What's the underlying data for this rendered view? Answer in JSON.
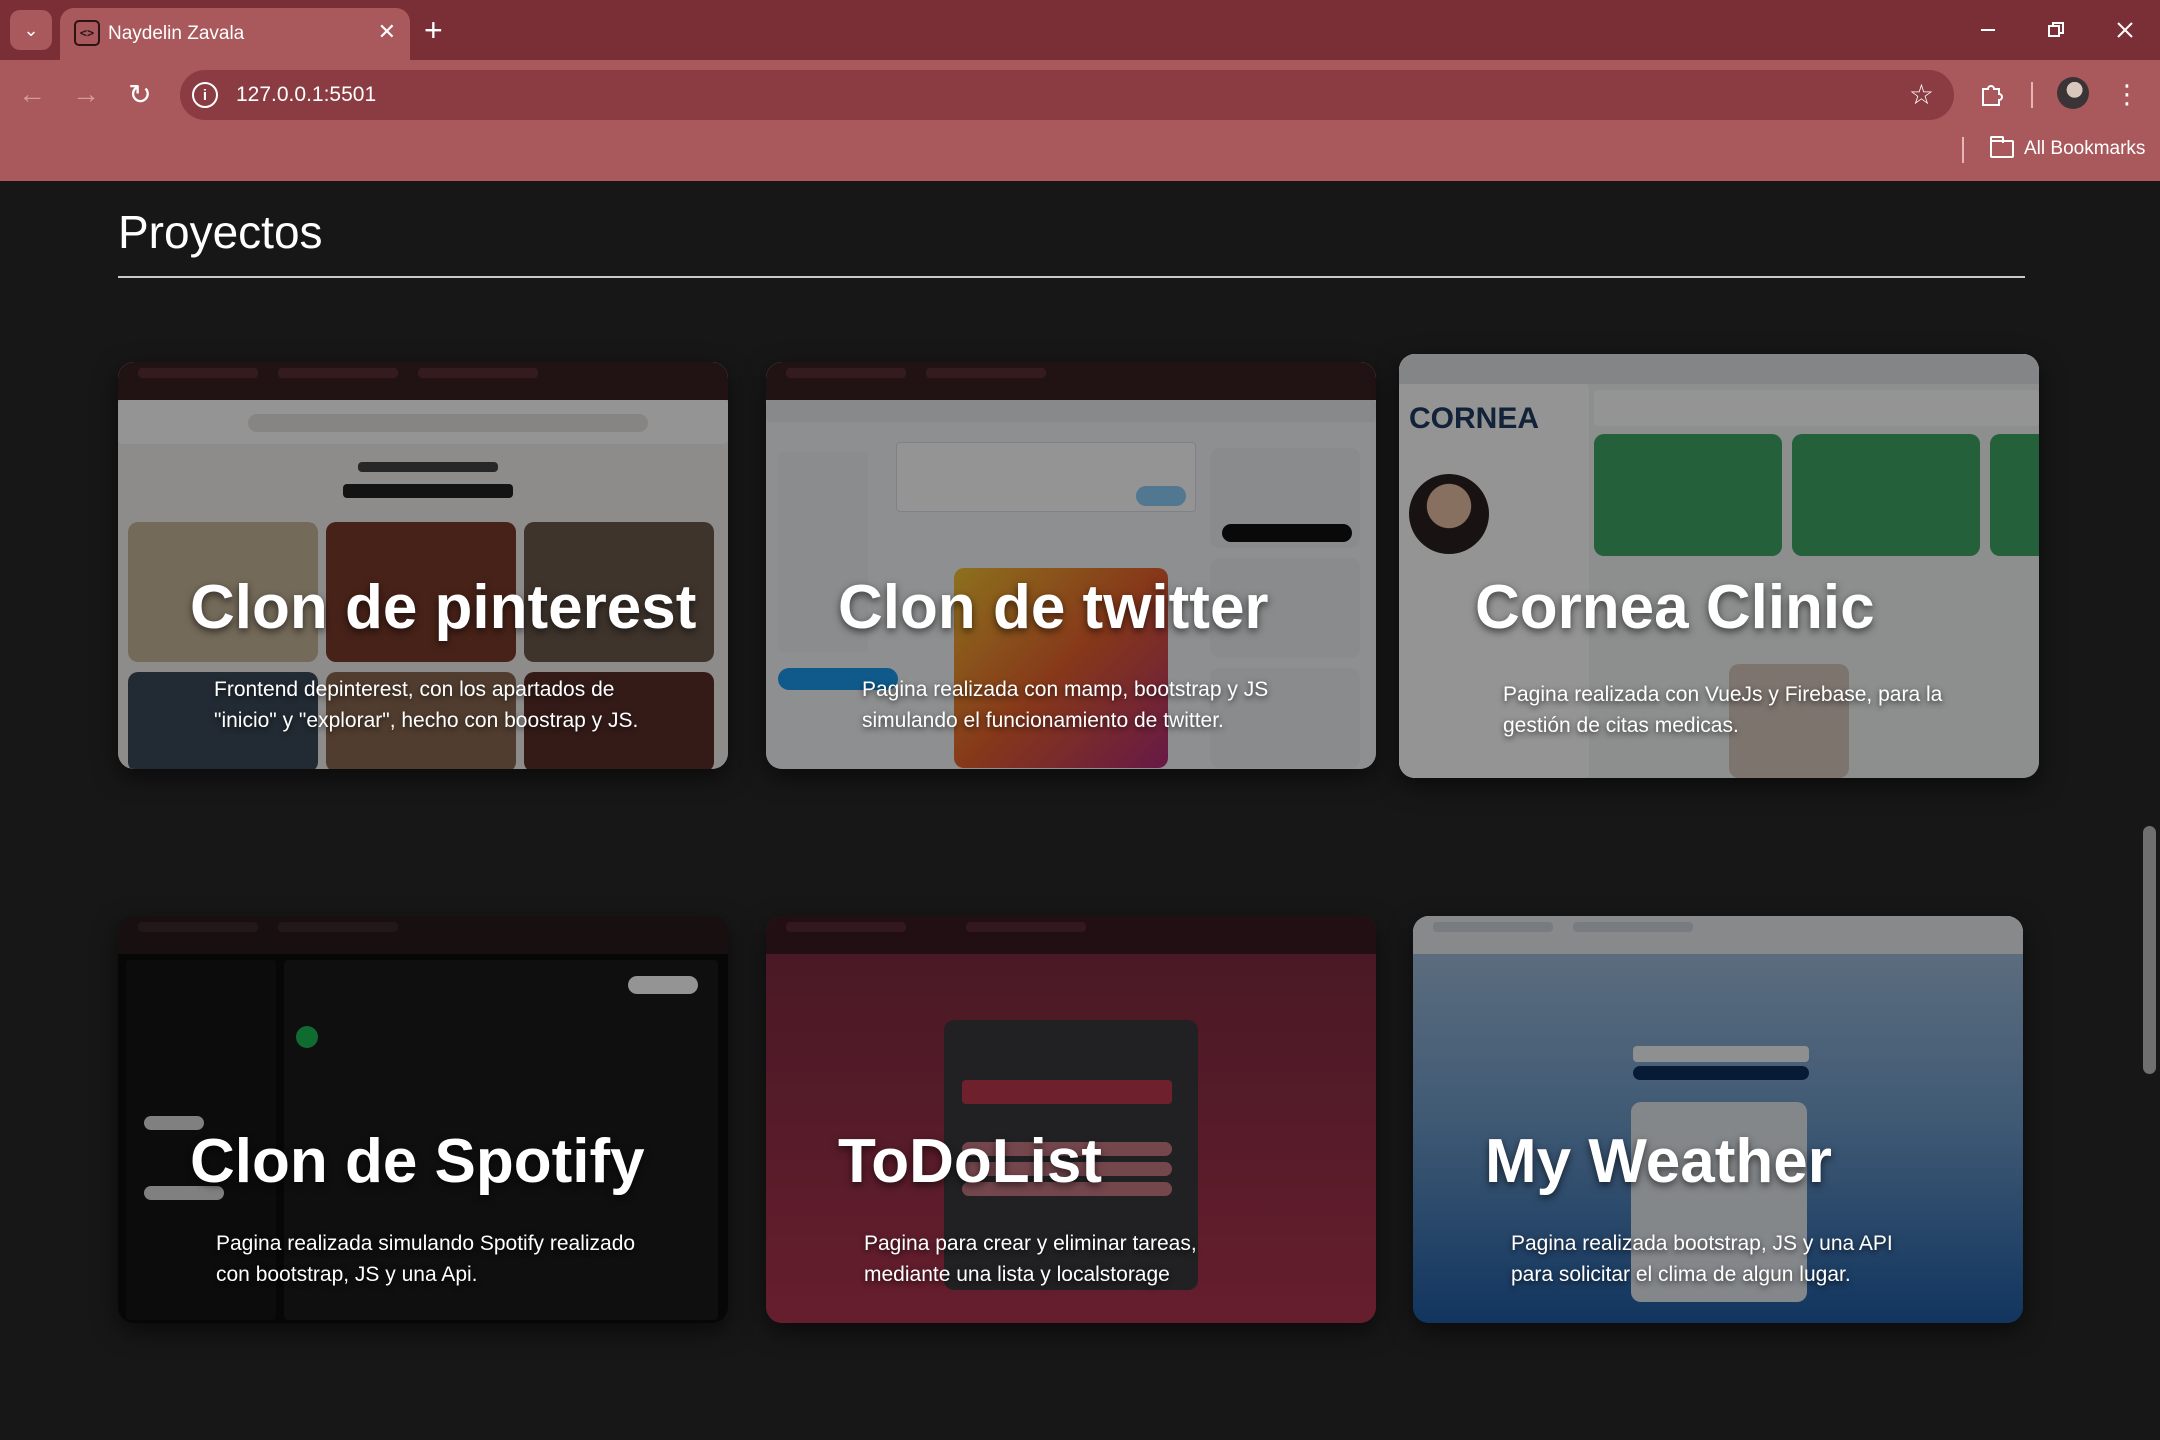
{
  "browser": {
    "tab_title": "Naydelin Zavala",
    "tab_close": "✕",
    "new_tab": "+",
    "url": "127.0.0.1:5501",
    "bookmarks_label": "All Bookmarks"
  },
  "page": {
    "section_title": "Proyectos"
  },
  "projects": [
    {
      "title": "Clon de pinterest",
      "description": "Frontend depinterest, con los apartados de \"inicio\" y \"explorar\", hecho con boostrap y JS."
    },
    {
      "title": "Clon de twitter",
      "description": "Pagina realizada con mamp, bootstrap y JS simulando el funcionamiento de twitter."
    },
    {
      "title": "Cornea Clinic",
      "description": "Pagina realizada con VueJs y Firebase, para la gestión de citas medicas."
    },
    {
      "title": "Clon de Spotify",
      "description": "Pagina realizada simulando Spotify realizado con bootstrap, JS y una Api."
    },
    {
      "title": "ToDoList",
      "description": "Pagina para crear y eliminar tareas, mediante una lista y localstorage"
    },
    {
      "title": "My Weather",
      "description": "Pagina realizada bootstrap, JS y una API para solicitar el clima de algun lugar."
    }
  ],
  "colors": {
    "chrome": "#a9585c",
    "tabstrip": "#7a2f36",
    "page_bg": "#171717"
  }
}
